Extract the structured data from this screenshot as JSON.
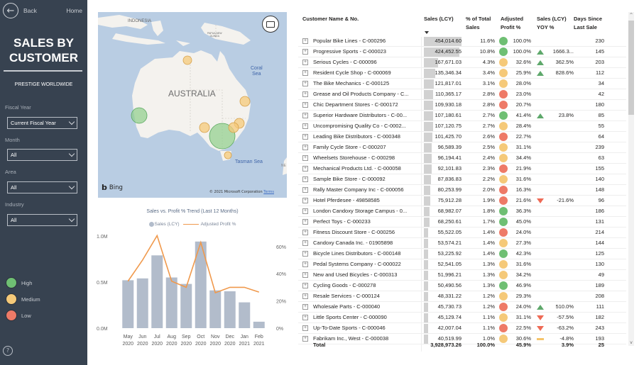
{
  "nav": {
    "back_label": "Back",
    "home_label": "Home"
  },
  "sidebar": {
    "title_line1": "SALES BY",
    "title_line2": "CUSTOMER",
    "company": "PRESTIGE WORLDWIDE",
    "filters": [
      {
        "label": "Fiscal Year",
        "value": "Current Fiscal Year"
      },
      {
        "label": "Month",
        "value": "All"
      },
      {
        "label": "Area",
        "value": "All"
      },
      {
        "label": "Industry",
        "value": "All"
      }
    ],
    "legend": [
      {
        "label": "High",
        "color": "#6fbf73"
      },
      {
        "label": "Medium",
        "color": "#f5c979"
      },
      {
        "label": "Low",
        "color": "#ee7a67"
      }
    ],
    "help_icon": "?"
  },
  "map": {
    "labels": {
      "indonesia": "INDONESIA",
      "png_line1": "PAPUA NEW",
      "png_line2": "GUINEA",
      "coral_line1": "Coral",
      "coral_line2": "Sea",
      "australia": "AUSTRALIA",
      "tasman": "Tasman Sea",
      "ne": "NE"
    },
    "bing": "Bing",
    "copyright": "© 2021 Microsoft Corporation",
    "terms": "Terms",
    "bubbles": [
      {
        "location": "Darwin",
        "category": "Medium",
        "size": "small"
      },
      {
        "location": "Brisbane",
        "category": "Medium",
        "size": "small"
      },
      {
        "location": "Perth",
        "category": "High",
        "size": "medium"
      },
      {
        "location": "Adelaide",
        "category": "Medium",
        "size": "small"
      },
      {
        "location": "Melbourne",
        "category": "High",
        "size": "large"
      },
      {
        "location": "Canberra",
        "category": "Medium",
        "size": "small"
      },
      {
        "location": "Sydney",
        "category": "Medium",
        "size": "small"
      },
      {
        "location": "Hobart",
        "category": "Medium",
        "size": "tiny"
      }
    ]
  },
  "chart_data": {
    "type": "bar",
    "title": "Sales vs. Profit % Trend (Last 12 Months)",
    "legend": [
      "Sales (LCY)",
      "Adjusted Profit %"
    ],
    "legend_position": "top-center",
    "categories": [
      "May 2020",
      "Jun 2020",
      "Jul 2020",
      "Aug 2020",
      "Sep 2020",
      "Oct 2020",
      "Nov 2020",
      "Dec 2020",
      "Jan 2021",
      "Feb 2021"
    ],
    "series": [
      {
        "name": "Sales (LCY)",
        "type": "bar",
        "axis": "left",
        "color": "#b2bccb",
        "values": [
          0.52,
          0.54,
          0.79,
          0.55,
          0.48,
          0.94,
          0.41,
          0.4,
          0.28,
          0.07
        ]
      },
      {
        "name": "Adjusted Profit %",
        "type": "line",
        "axis": "right",
        "color": "#f0994c",
        "values": [
          34.5,
          50,
          68,
          34.5,
          30,
          63,
          26,
          30,
          30,
          26.5
        ]
      }
    ],
    "y_left": {
      "ticks": [
        "0.0M",
        "0.5M",
        "1.0M"
      ],
      "range": [
        0,
        1.0
      ],
      "unit": "M"
    },
    "y_right": {
      "ticks": [
        "0%",
        "20%",
        "40%",
        "60%"
      ],
      "range": [
        0,
        70
      ],
      "unit": "%"
    },
    "grid": false
  },
  "table": {
    "headers": {
      "customer": "Customer Name & No.",
      "sales": "Sales (LCY)",
      "pct_line1": "% of Total",
      "pct_line2": "Sales",
      "profit_line1": "Adjusted",
      "profit_line2": "Profit %",
      "yoy_line1": "Sales (LCY)",
      "yoy_line2": "YOY %",
      "days_line1": "Days Since",
      "days_line2": "Last Sale"
    },
    "rows": [
      {
        "name": "Popular Bike Lines - C-000296",
        "sales": "454,014.60",
        "sales_num": 454014.6,
        "pct": "11.6%",
        "kpi": "High",
        "profit": "100.0%",
        "yoy_dir": "",
        "yoy": "",
        "days": "230"
      },
      {
        "name": "Progressive Sports - C-000023",
        "sales": "424,452.55",
        "sales_num": 424452.55,
        "pct": "10.8%",
        "kpi": "High",
        "profit": "100.0%",
        "yoy_dir": "up",
        "yoy": "1666.3...",
        "days": "145"
      },
      {
        "name": "Serious Cycles - C-000096",
        "sales": "167,671.03",
        "sales_num": 167671.03,
        "pct": "4.3%",
        "kpi": "Medium",
        "profit": "32.6%",
        "yoy_dir": "up",
        "yoy": "362.5%",
        "days": "203"
      },
      {
        "name": "Resident Cycle Shop - C-000069",
        "sales": "135,346.34",
        "sales_num": 135346.34,
        "pct": "3.4%",
        "kpi": "Medium",
        "profit": "25.9%",
        "yoy_dir": "up",
        "yoy": "828.6%",
        "days": "112"
      },
      {
        "name": "The Bike Mechanics - C-000125",
        "sales": "121,817.01",
        "sales_num": 121817.01,
        "pct": "3.1%",
        "kpi": "Medium",
        "profit": "28.0%",
        "yoy_dir": "",
        "yoy": "",
        "days": "34"
      },
      {
        "name": "Grease and Oil Products Company - C...",
        "sales": "110,365.17",
        "sales_num": 110365.17,
        "pct": "2.8%",
        "kpi": "Low",
        "profit": "23.0%",
        "yoy_dir": "",
        "yoy": "",
        "days": "42"
      },
      {
        "name": "Chic Department Stores - C-000172",
        "sales": "109,930.18",
        "sales_num": 109930.18,
        "pct": "2.8%",
        "kpi": "Low",
        "profit": "20.7%",
        "yoy_dir": "",
        "yoy": "",
        "days": "180"
      },
      {
        "name": "Superior Hardware Distributors - C-00...",
        "sales": "107,180.61",
        "sales_num": 107180.61,
        "pct": "2.7%",
        "kpi": "High",
        "profit": "41.4%",
        "yoy_dir": "up",
        "yoy": "23.8%",
        "days": "85"
      },
      {
        "name": "Uncompromising Quality Co - C-0002...",
        "sales": "107,120.75",
        "sales_num": 107120.75,
        "pct": "2.7%",
        "kpi": "Medium",
        "profit": "28.4%",
        "yoy_dir": "",
        "yoy": "",
        "days": "55"
      },
      {
        "name": "Leading Bike Distributors - C-000348",
        "sales": "101,425.70",
        "sales_num": 101425.7,
        "pct": "2.6%",
        "kpi": "Low",
        "profit": "22.7%",
        "yoy_dir": "",
        "yoy": "",
        "days": "64"
      },
      {
        "name": "Family Cycle Store - C-000207",
        "sales": "96,589.39",
        "sales_num": 96589.39,
        "pct": "2.5%",
        "kpi": "Medium",
        "profit": "31.1%",
        "yoy_dir": "",
        "yoy": "",
        "days": "239"
      },
      {
        "name": "Wheelsets Storehouse - C-000298",
        "sales": "96,194.41",
        "sales_num": 96194.41,
        "pct": "2.4%",
        "kpi": "Medium",
        "profit": "34.4%",
        "yoy_dir": "",
        "yoy": "",
        "days": "63"
      },
      {
        "name": "Mechanical Products Ltd. - C-000058",
        "sales": "92,101.83",
        "sales_num": 92101.83,
        "pct": "2.3%",
        "kpi": "Low",
        "profit": "21.9%",
        "yoy_dir": "",
        "yoy": "",
        "days": "155"
      },
      {
        "name": "Sample Bike Store - C-000092",
        "sales": "87,836.83",
        "sales_num": 87836.83,
        "pct": "2.2%",
        "kpi": "Medium",
        "profit": "31.6%",
        "yoy_dir": "",
        "yoy": "",
        "days": "140"
      },
      {
        "name": "Rally Master Company Inc - C-000056",
        "sales": "80,253.99",
        "sales_num": 80253.99,
        "pct": "2.0%",
        "kpi": "Low",
        "profit": "16.3%",
        "yoy_dir": "",
        "yoy": "",
        "days": "148"
      },
      {
        "name": "Hotel Pferdesee - 49858585",
        "sales": "75,912.28",
        "sales_num": 75912.28,
        "pct": "1.9%",
        "kpi": "Low",
        "profit": "21.6%",
        "yoy_dir": "down",
        "yoy": "-21.6%",
        "days": "96"
      },
      {
        "name": "London Candoxy Storage Campus - 0...",
        "sales": "68,982.07",
        "sales_num": 68982.07,
        "pct": "1.8%",
        "kpi": "High",
        "profit": "36.3%",
        "yoy_dir": "",
        "yoy": "",
        "days": "186"
      },
      {
        "name": "Perfect Toys - C-000233",
        "sales": "68,250.61",
        "sales_num": 68250.61,
        "pct": "1.7%",
        "kpi": "High",
        "profit": "45.0%",
        "yoy_dir": "",
        "yoy": "",
        "days": "131"
      },
      {
        "name": "Fitness Discount Store - C-000256",
        "sales": "55,522.05",
        "sales_num": 55522.05,
        "pct": "1.4%",
        "kpi": "Low",
        "profit": "24.0%",
        "yoy_dir": "",
        "yoy": "",
        "days": "214"
      },
      {
        "name": "Candoxy Canada Inc. - 01905898",
        "sales": "53,574.21",
        "sales_num": 53574.21,
        "pct": "1.4%",
        "kpi": "Medium",
        "profit": "27.3%",
        "yoy_dir": "",
        "yoy": "",
        "days": "144"
      },
      {
        "name": "Bicycle Lines Distributors - C-000148",
        "sales": "53,225.92",
        "sales_num": 53225.92,
        "pct": "1.4%",
        "kpi": "High",
        "profit": "42.3%",
        "yoy_dir": "",
        "yoy": "",
        "days": "125"
      },
      {
        "name": "Pedal Systems Company - C-000022",
        "sales": "52,541.05",
        "sales_num": 52541.05,
        "pct": "1.3%",
        "kpi": "Medium",
        "profit": "31.6%",
        "yoy_dir": "",
        "yoy": "",
        "days": "130"
      },
      {
        "name": "New and Used Bicycles - C-000313",
        "sales": "51,996.21",
        "sales_num": 51996.21,
        "pct": "1.3%",
        "kpi": "Medium",
        "profit": "34.2%",
        "yoy_dir": "",
        "yoy": "",
        "days": "49"
      },
      {
        "name": "Cycling Goods - C-000278",
        "sales": "50,490.56",
        "sales_num": 50490.56,
        "pct": "1.3%",
        "kpi": "High",
        "profit": "46.9%",
        "yoy_dir": "",
        "yoy": "",
        "days": "189"
      },
      {
        "name": "Resale Services - C-000124",
        "sales": "48,331.22",
        "sales_num": 48331.22,
        "pct": "1.2%",
        "kpi": "Medium",
        "profit": "29.3%",
        "yoy_dir": "",
        "yoy": "",
        "days": "208"
      },
      {
        "name": "Wholesale Parts - C-000040",
        "sales": "45,730.73",
        "sales_num": 45730.73,
        "pct": "1.2%",
        "kpi": "Low",
        "profit": "24.0%",
        "yoy_dir": "up",
        "yoy": "510.0%",
        "days": "111"
      },
      {
        "name": "Little Sports Center - C-000090",
        "sales": "45,129.74",
        "sales_num": 45129.74,
        "pct": "1.1%",
        "kpi": "Medium",
        "profit": "31.1%",
        "yoy_dir": "down",
        "yoy": "-57.5%",
        "days": "182"
      },
      {
        "name": "Up-To-Date Sports - C-000046",
        "sales": "42,007.04",
        "sales_num": 42007.04,
        "pct": "1.1%",
        "kpi": "Low",
        "profit": "22.5%",
        "yoy_dir": "down",
        "yoy": "-63.2%",
        "days": "243"
      },
      {
        "name": "Fabrikam Inc., West - C-000038",
        "sales": "40,519.99",
        "sales_num": 40519.99,
        "pct": "1.0%",
        "kpi": "Medium",
        "profit": "30.6%",
        "yoy_dir": "flat",
        "yoy": "-4.8%",
        "days": "193"
      }
    ],
    "total": {
      "label": "Total",
      "sales": "3,928,973.26",
      "pct": "100.0%",
      "profit": "45.9%",
      "yoy": "3.9%",
      "days": "25"
    },
    "kpi_colors": {
      "High": "#6fbf73",
      "Medium": "#f5c979",
      "Low": "#ee7a67"
    },
    "scroll_position": 0.0
  }
}
